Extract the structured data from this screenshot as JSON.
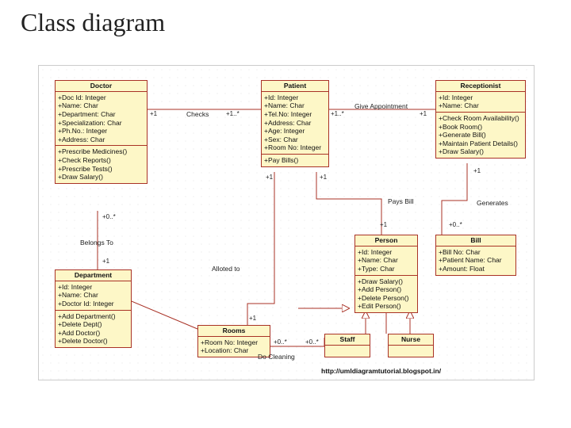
{
  "page": {
    "title": "Class diagram",
    "credit": "http://umldiagramtutorial.blogspot.in/"
  },
  "classes": {
    "doctor": {
      "name": "Doctor",
      "attrs": [
        "+Doc Id: Integer",
        "+Name: Char",
        "+Department: Char",
        "+Specialization: Char",
        "+Ph.No.: Integer",
        "+Address: Char"
      ],
      "ops": [
        "+Prescribe Medicines()",
        "+Check Reports()",
        "+Prescribe Tests()",
        "+Draw Salary()"
      ]
    },
    "patient": {
      "name": "Patient",
      "attrs": [
        "+Id: Integer",
        "+Name: Char",
        "+Tel.No: Integer",
        "+Address: Char",
        "+Age: Integer",
        "+Sex: Char",
        "+Room No: Integer"
      ],
      "ops": [
        "+Pay Bills()"
      ]
    },
    "receptionist": {
      "name": "Receptionist",
      "attrs": [
        "+Id: Integer",
        "+Name: Char"
      ],
      "ops": [
        "+Check Room Availability()",
        "+Book Room()",
        "+Generate Bill()",
        "+Maintain Patient Details()",
        "+Draw Salary()"
      ]
    },
    "department": {
      "name": "Department",
      "attrs": [
        "+Id: Integer",
        "+Name: Char",
        "+Doctor Id: Integer"
      ],
      "ops": [
        "+Add Department()",
        "+Delete Dept()",
        "+Add Doctor()",
        "+Delete Doctor()"
      ]
    },
    "person": {
      "name": "Person",
      "attrs": [
        "+Id: Integer",
        "+Name: Char",
        "+Type: Char"
      ],
      "ops": [
        "+Draw Salary()",
        "+Add Person()",
        "+Delete Person()",
        "+Edit Person()"
      ]
    },
    "bill": {
      "name": "Bill",
      "attrs": [
        "+Bill No: Char",
        "+Patient Name: Char",
        "+Amount: Float"
      ],
      "ops": []
    },
    "rooms": {
      "name": "Rooms",
      "attrs": [
        "+Room No: Integer",
        "+Location: Char"
      ],
      "ops": []
    },
    "staff": {
      "name": "Staff",
      "attrs": [],
      "ops": []
    },
    "nurse": {
      "name": "Nurse",
      "attrs": [],
      "ops": []
    }
  },
  "relations": {
    "checks": {
      "label": "Checks",
      "m1": "+1",
      "m2": "+1..*"
    },
    "giveAppt": {
      "label": "Give Appointment",
      "m1": "+1..*",
      "m2": "+1"
    },
    "paysBill": {
      "label": "Pays Bill",
      "m1": "+1",
      "m2": "+1"
    },
    "generates": {
      "label": "Generates",
      "m1": "+1",
      "m2": "+0..*"
    },
    "belongsTo": {
      "label": "Belongs To",
      "m1": "+0..*",
      "m2": "+1"
    },
    "allotedTo": {
      "label": "Alloted to",
      "m1": "+1",
      "m2": "+1"
    },
    "doCleaning": {
      "label": "Do Cleaning",
      "m1": "+0..*",
      "m2": "+0..*"
    }
  }
}
